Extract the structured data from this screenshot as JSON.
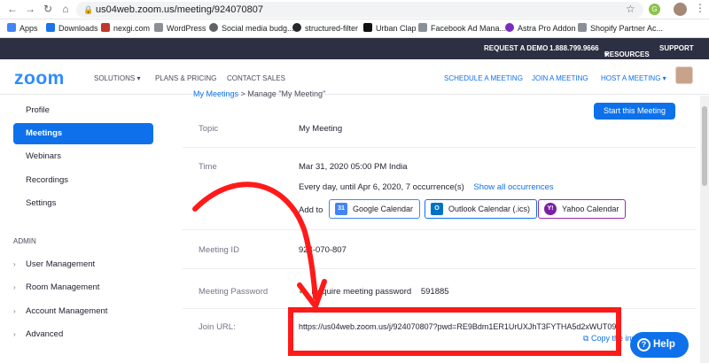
{
  "browser": {
    "url": "us04web.zoom.us/meeting/924070807",
    "back_icon": "arrow-left-icon",
    "forward_icon": "arrow-right-icon",
    "reload_icon": "reload-icon",
    "home_icon": "home-icon",
    "ext_label": "G"
  },
  "bookmarks": [
    {
      "label": "Apps",
      "color": "#4285f4"
    },
    {
      "label": "Downloads",
      "color": "#1a73e8"
    },
    {
      "label": "nexgi.com",
      "color": "#c0392b"
    },
    {
      "label": "WordPress",
      "color": "#5f6368"
    },
    {
      "label": "Social media budg...",
      "color": "#5f6368"
    },
    {
      "label": "structured-filter",
      "color": "#24292e"
    },
    {
      "label": "Urban Clap",
      "color": "#111111"
    },
    {
      "label": "Facebook Ad Mana...",
      "color": "#5f6368"
    },
    {
      "label": "Astra Pro Addon",
      "color": "#7b2cbf"
    },
    {
      "label": "Shopify Partner Ac...",
      "color": "#5f6368"
    }
  ],
  "topbar": {
    "request_demo": "REQUEST A DEMO",
    "phone": "1.888.799.9666",
    "resources": "RESOURCES",
    "support": "SUPPORT"
  },
  "nav": {
    "logo": "zoom",
    "solutions": "SOLUTIONS",
    "plans": "PLANS & PRICING",
    "contact": "CONTACT SALES",
    "schedule": "SCHEDULE A MEETING",
    "join": "JOIN A MEETING",
    "host": "HOST A MEETING"
  },
  "sidebar": {
    "items": [
      "Profile",
      "Meetings",
      "Webinars",
      "Recordings",
      "Settings"
    ],
    "admin_label": "ADMIN",
    "admin_items": [
      "User Management",
      "Room Management",
      "Account Management",
      "Advanced"
    ]
  },
  "main": {
    "breadcrumb_link": "My Meetings",
    "breadcrumb_sep": ">",
    "breadcrumb_current": "Manage \"My Meeting\"",
    "start_button": "Start this Meeting",
    "topic_label": "Topic",
    "topic_value": "My Meeting",
    "time_label": "Time",
    "time_value": "Mar 31, 2020 05:00 PM India",
    "recurrence": "Every day, until Apr 6, 2020, 7 occurrence(s)",
    "show_all": "Show all occurrences",
    "add_to": "Add to",
    "google_cal": "Google Calendar",
    "outlook_cal": "Outlook Calendar (.ics)",
    "yahoo_cal": "Yahoo Calendar",
    "meeting_id_label": "Meeting ID",
    "meeting_id_value": "924-070-807",
    "password_label": "Meeting Password",
    "password_text": "Require meeting password",
    "password_value": "591885",
    "join_label": "Join URL:",
    "join_url": "https://us04web.zoom.us/j/924070807?pwd=RE9Bdm1ER1UrUXJhT3FYTHA5d2xWUT09",
    "copy_label": "Copy the invitation"
  },
  "help": {
    "label": "Help"
  },
  "colors": {
    "zoom_blue": "#0e71eb",
    "annotation_red": "#ff1a1a",
    "topbar": "#2d3042"
  }
}
